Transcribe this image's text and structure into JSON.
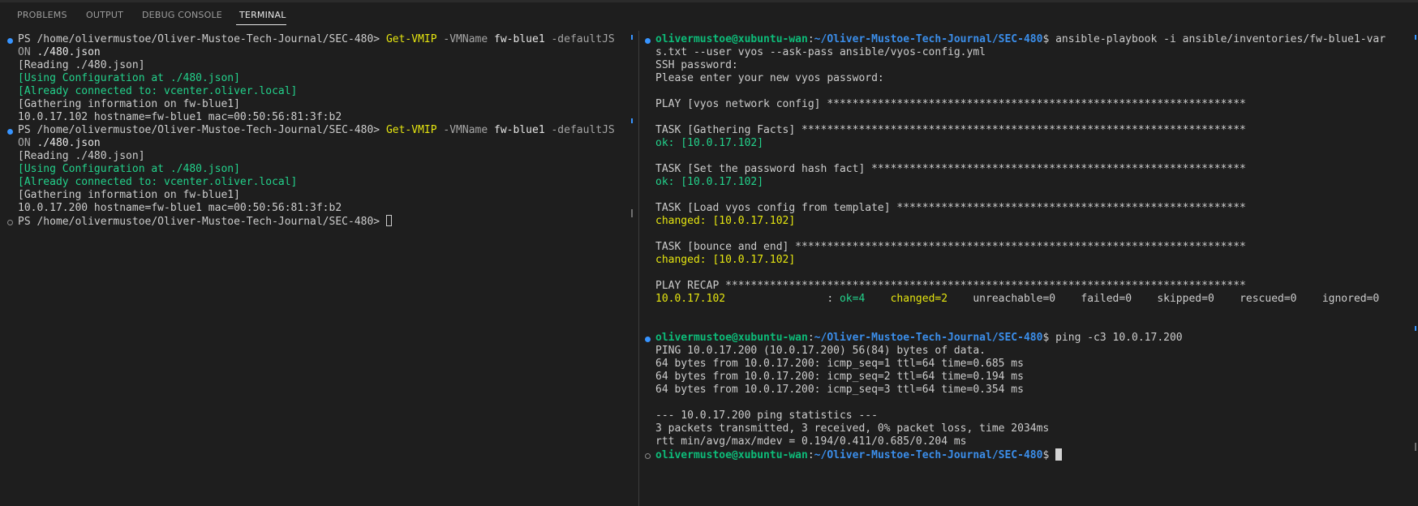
{
  "tabs": [
    {
      "label": "PROBLEMS"
    },
    {
      "label": "OUTPUT"
    },
    {
      "label": "DEBUG CONSOLE"
    },
    {
      "label": "TERMINAL"
    }
  ],
  "colors": {
    "background": "#1e1e1e",
    "prompt_user": "#0dbc79",
    "prompt_path": "#3b8eea",
    "command_yellow": "#e5e510",
    "green": "#23d18b",
    "marker_blue": "#3794ff"
  },
  "left": {
    "prompt": "PS /home/olivermustoe/Oliver-Mustoe-Tech-Journal/SEC-480> ",
    "cmd_name": "Get-VMIP",
    "cmd_param1": " -VMName",
    "cmd_value1": " fw-blue1",
    "cmd_param2": " -defaultJS",
    "cmd_wrap_param": "ON",
    "cmd_wrap_value": " ./480.json",
    "reading": "[Reading ./480.json]",
    "using_config": "[Using Configuration at ./480.json]",
    "already_connected": "[Already connected to: vcenter.oliver.local]",
    "gathering": "[Gathering information on fw-blue1]",
    "result1": "10.0.17.102 hostname=fw-blue1 mac=00:50:56:81:3f:b2",
    "result2": "10.0.17.200 hostname=fw-blue1 mac=00:50:56:81:3f:b2",
    "final_prompt": "PS /home/olivermustoe/Oliver-Mustoe-Tech-Journal/SEC-480> "
  },
  "right": {
    "user_host": "olivermustoe@xubuntu-wan",
    "sep": ":",
    "path": "~/Oliver-Mustoe-Tech-Journal/SEC-480",
    "dollar": "$ ",
    "ansible_cmd": "ansible-playbook -i ansible/inventories/fw-blue1-var",
    "ansible_cmd_wrap": "s.txt --user vyos --ask-pass ansible/vyos-config.yml",
    "ssh_password": "SSH password:",
    "enter_password": "Please enter your new vyos password:",
    "play_header": "PLAY [vyos network config] ******************************************************************",
    "task1": "TASK [Gathering Facts] **********************************************************************",
    "task1_result": "ok: [10.0.17.102]",
    "task2": "TASK [Set the password hash fact] ***********************************************************",
    "task2_result": "ok: [10.0.17.102]",
    "task3": "TASK [Load vyos config from template] *******************************************************",
    "task3_result": "changed: [10.0.17.102]",
    "task4": "TASK [bounce and end] ***********************************************************************",
    "task4_result": "changed: [10.0.17.102]",
    "recap_header": "PLAY RECAP **********************************************************************************",
    "recap_host": "10.0.17.102",
    "recap_colon": "                : ",
    "recap_ok": "ok=4",
    "recap_changed": "    changed=2",
    "recap_rest": "    unreachable=0    failed=0    skipped=0    rescued=0    ignored=0",
    "ping_cmd": "ping -c3 10.0.17.200",
    "ping_header": "PING 10.0.17.200 (10.0.17.200) 56(84) bytes of data.",
    "ping_reply1": "64 bytes from 10.0.17.200: icmp_seq=1 ttl=64 time=0.685 ms",
    "ping_reply2": "64 bytes from 10.0.17.200: icmp_seq=2 ttl=64 time=0.194 ms",
    "ping_reply3": "64 bytes from 10.0.17.200: icmp_seq=3 ttl=64 time=0.354 ms",
    "ping_stats_header": "--- 10.0.17.200 ping statistics ---",
    "ping_stats": "3 packets transmitted, 3 received, 0% packet loss, time 2034ms",
    "ping_rtt": "rtt min/avg/max/mdev = 0.194/0.411/0.685/0.204 ms"
  }
}
